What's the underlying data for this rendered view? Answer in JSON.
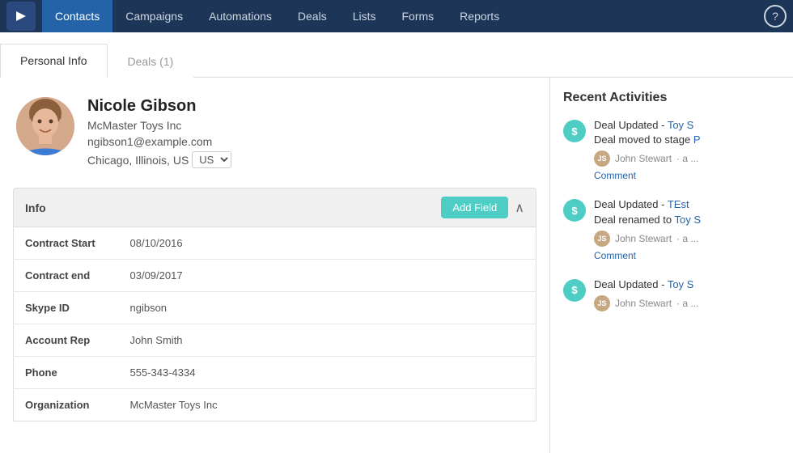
{
  "nav": {
    "items": [
      {
        "label": "Contacts",
        "active": true
      },
      {
        "label": "Campaigns",
        "active": false
      },
      {
        "label": "Automations",
        "active": false
      },
      {
        "label": "Deals",
        "active": false
      },
      {
        "label": "Lists",
        "active": false
      },
      {
        "label": "Forms",
        "active": false
      },
      {
        "label": "Reports",
        "active": false
      }
    ],
    "help_label": "?"
  },
  "tabs": [
    {
      "label": "Personal Info",
      "active": true
    },
    {
      "label": "Deals (1)",
      "active": false
    }
  ],
  "profile": {
    "name": "Nicole Gibson",
    "company": "McMaster Toys Inc",
    "email": "ngibson1@example.com",
    "location": "Chicago, Illinois, US"
  },
  "info_section": {
    "title": "Info",
    "add_field_label": "Add Field",
    "collapse_icon": "∧",
    "fields": [
      {
        "label": "Contract Start",
        "value": "08/10/2016"
      },
      {
        "label": "Contract end",
        "value": "03/09/2017"
      },
      {
        "label": "Skype ID",
        "value": "ngibson"
      },
      {
        "label": "Account Rep",
        "value": "John Smith"
      },
      {
        "label": "Phone",
        "value": "555-343-4334"
      },
      {
        "label": "Organization",
        "value": "McMaster Toys Inc"
      }
    ]
  },
  "recent_activities": {
    "title": "Recent Activities",
    "items": [
      {
        "icon": "$",
        "title_text": "Deal Updated - ",
        "title_link": "Toy S",
        "subtitle": "Deal moved to stage ",
        "subtitle_link": "P",
        "user": "John Stewart",
        "time": "· a ...",
        "comment_label": "Comment"
      },
      {
        "icon": "$",
        "title_text": "Deal Updated - ",
        "title_link": "TEst",
        "subtitle": "Deal renamed to ",
        "subtitle_link": "Toy S",
        "user": "John Stewart",
        "time": "· a ...",
        "comment_label": "Comment"
      },
      {
        "icon": "$",
        "title_text": "Deal Updated - ",
        "title_link": "Toy S",
        "subtitle": "",
        "subtitle_link": "",
        "user": "John Stewart",
        "time": "· a ...",
        "comment_label": ""
      }
    ]
  }
}
